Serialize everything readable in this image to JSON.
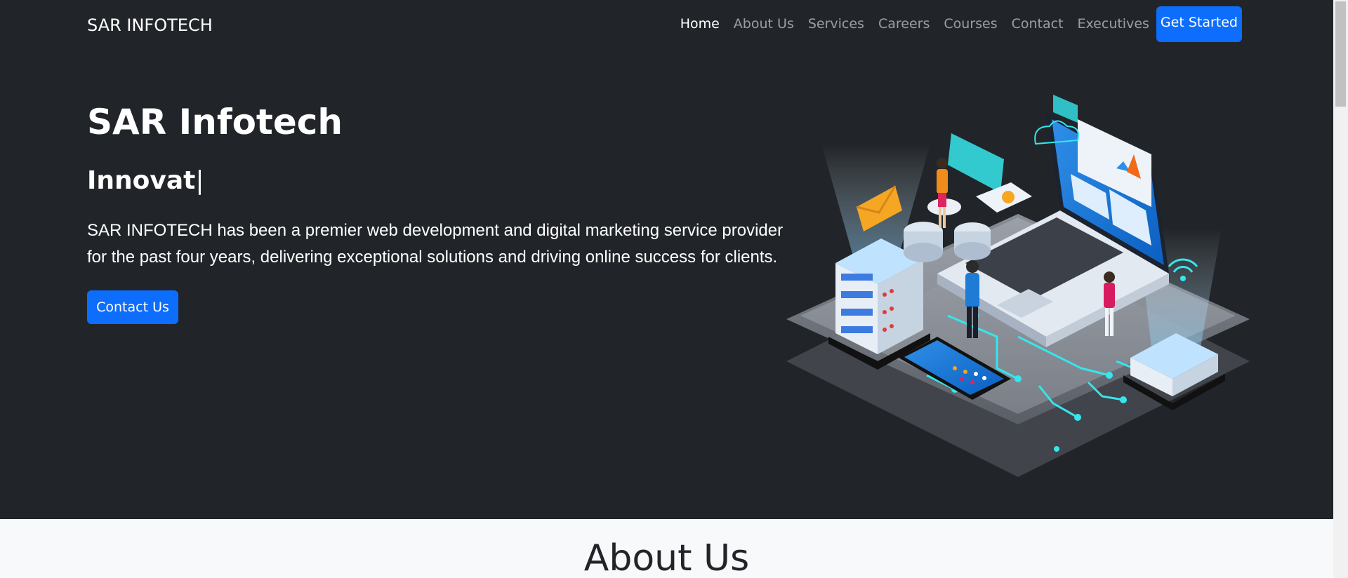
{
  "navbar": {
    "brand": "SAR INFOTECH",
    "links": [
      {
        "label": "Home",
        "active": true
      },
      {
        "label": "About Us",
        "active": false
      },
      {
        "label": "Services",
        "active": false
      },
      {
        "label": "Careers",
        "active": false
      },
      {
        "label": "Courses",
        "active": false
      },
      {
        "label": "Contact",
        "active": false
      },
      {
        "label": "Executives",
        "active": false
      }
    ],
    "cta_label": "Get Started"
  },
  "hero": {
    "title": "SAR Infotech",
    "typed_text": "Innovat",
    "typed_cursor": "|",
    "description": "SAR INFOTECH has been a premier web development and digital marketing service provider for the past four years, delivering exceptional solutions and driving online success for clients.",
    "button_label": "Contact Us",
    "illustration_icon": "isometric-tech-illustration"
  },
  "about": {
    "title": "About Us"
  },
  "colors": {
    "background": "#212529",
    "primary": "#0d6efd",
    "section_light": "#f8f9fa"
  }
}
